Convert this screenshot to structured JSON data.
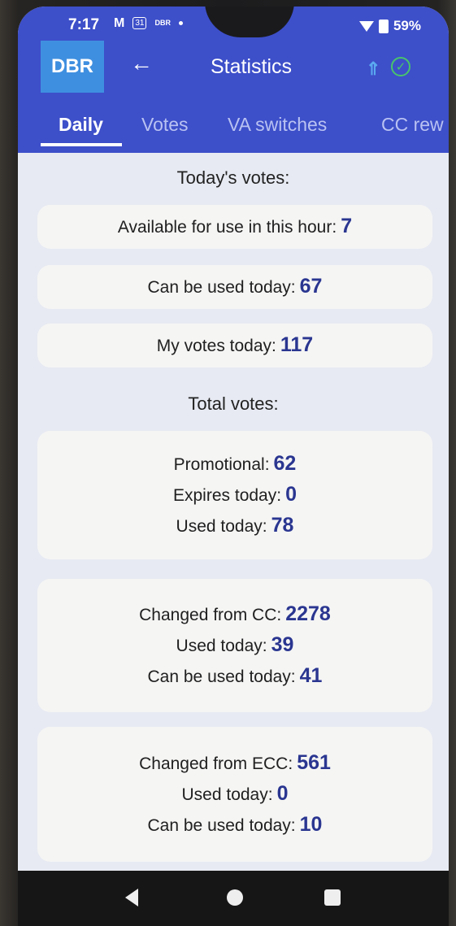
{
  "status": {
    "time": "7:17",
    "icon_date": "31",
    "icon_dbr": "DBR",
    "battery": "59%"
  },
  "app": {
    "logo": "DBR",
    "title": "Statistics",
    "icons": [
      "back-arrow-icon",
      "sync-icon",
      "check-circle-icon"
    ]
  },
  "tabs": [
    {
      "label": "Daily",
      "active": true
    },
    {
      "label": "Votes"
    },
    {
      "label": "VA switches"
    },
    {
      "label": "CC rew"
    }
  ],
  "today": {
    "heading": "Today's votes:",
    "available_label": "Available for use in this hour:",
    "available_value": "7",
    "can_use_label": "Can be used today:",
    "can_use_value": "67",
    "my_votes_label": "My votes today:",
    "my_votes_value": "117"
  },
  "total": {
    "heading": "Total votes:",
    "promo": {
      "promotional_label": "Promotional:",
      "promotional_value": "62",
      "expires_label": "Expires today:",
      "expires_value": "0",
      "used_label": "Used today:",
      "used_value": "78"
    },
    "cc": {
      "changed_label": "Changed from CC:",
      "changed_value": "2278",
      "used_label": "Used today:",
      "used_value": "39",
      "can_use_label": "Can be used today:",
      "can_use_value": "41"
    },
    "ecc": {
      "changed_label": "Changed from ECC:",
      "changed_value": "561",
      "used_label": "Used today:",
      "used_value": "0",
      "can_use_label": "Can be used today:",
      "can_use_value": "10"
    }
  },
  "colors": {
    "app_bar": "#3d4fc9",
    "logo_bg": "#3f8fe0",
    "value_text": "#2a3690",
    "background": "#e7eaf2",
    "card": "#f5f5f4"
  }
}
